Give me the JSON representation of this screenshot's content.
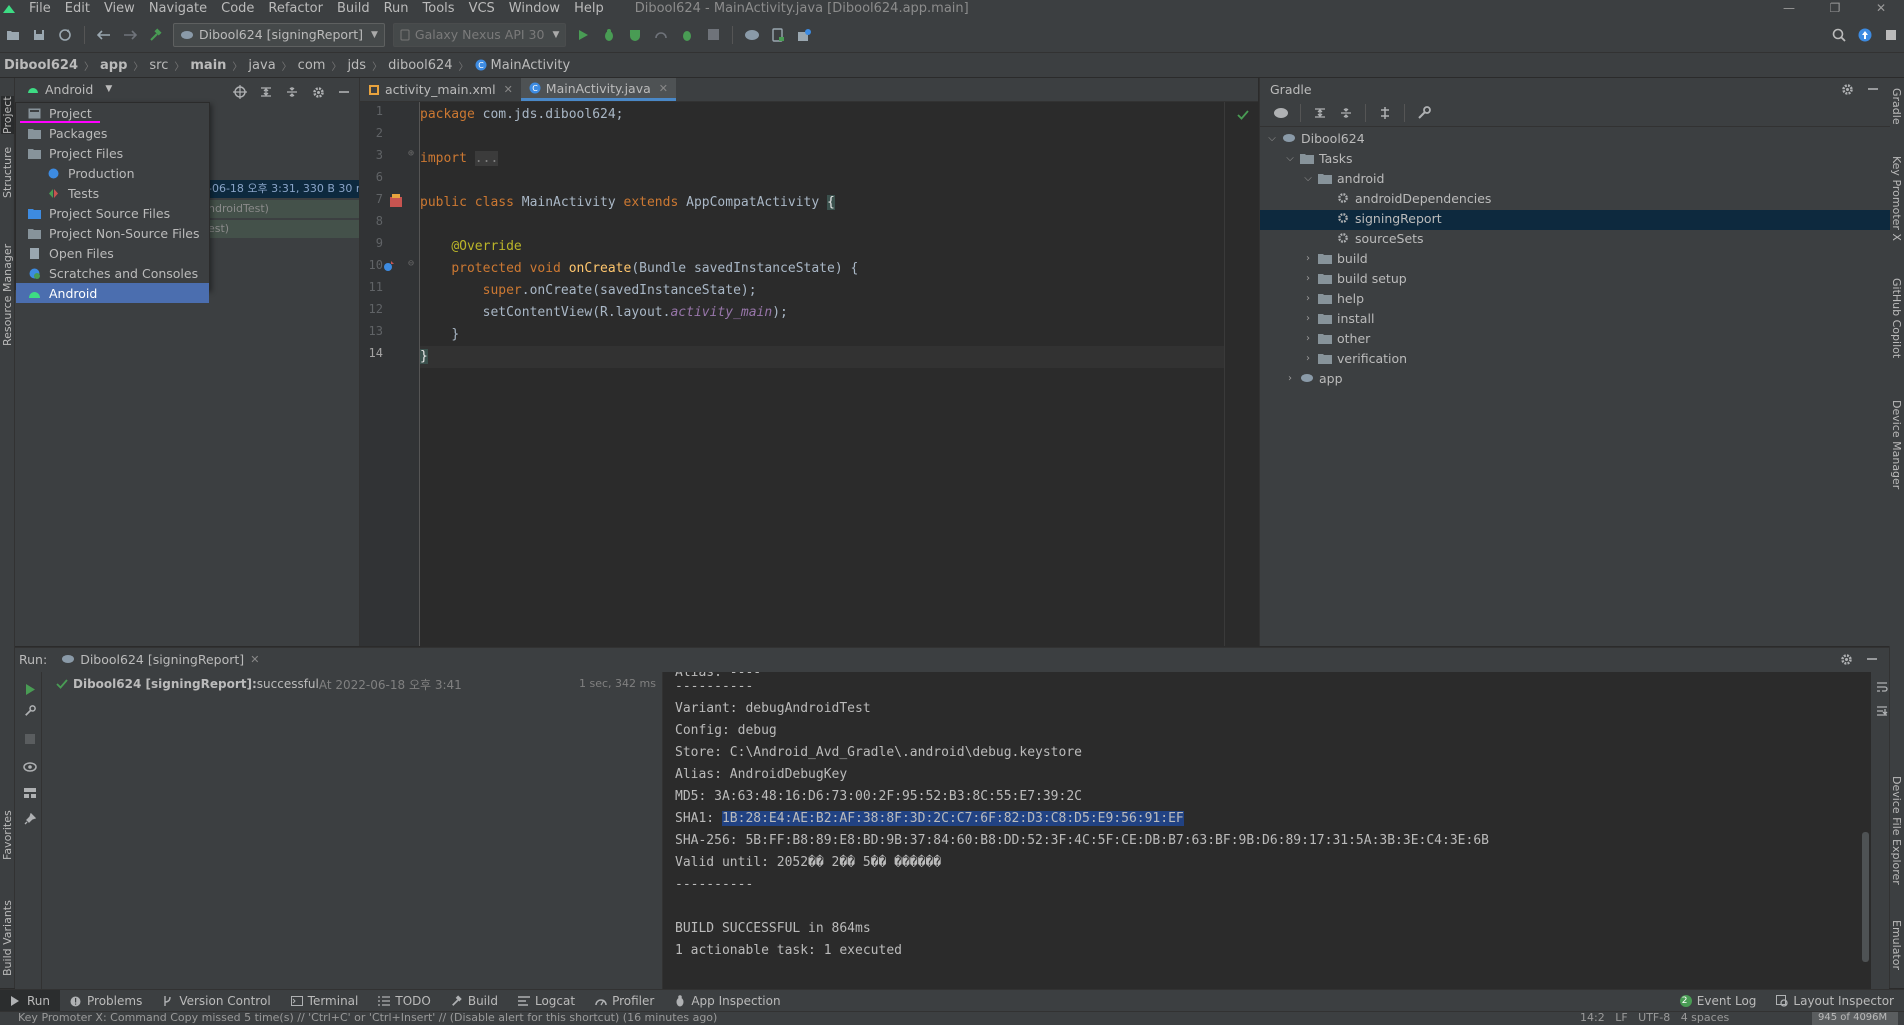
{
  "menu": {
    "items": [
      "File",
      "Edit",
      "View",
      "Navigate",
      "Code",
      "Refactor",
      "Build",
      "Run",
      "Tools",
      "VCS",
      "Window",
      "Help"
    ],
    "window_title": "Dibool624 - MainActivity.java [Dibool624.app.main]"
  },
  "toolbar": {
    "run_config": "Dibool624 [signingReport]",
    "device": "Galaxy Nexus API 30"
  },
  "breadcrumb": [
    "Dibool624",
    "app",
    "src",
    "main",
    "java",
    "com",
    "jds",
    "dibool624",
    "MainActivity"
  ],
  "project_panel": {
    "view_selector": "Android",
    "popup_items": [
      {
        "label": "Project"
      },
      {
        "label": "Packages"
      },
      {
        "label": "Project Files"
      },
      {
        "label": "Production"
      },
      {
        "label": "Tests"
      },
      {
        "label": "Project Source Files"
      },
      {
        "label": "Project Non-Source Files"
      },
      {
        "label": "Open Files"
      },
      {
        "label": "Scratches and Consoles"
      },
      {
        "label": "Android"
      }
    ],
    "selected_item": "Android",
    "behind_text": [
      "-06-18 오후 3:31, 330 B 30 m",
      "ndroidTest)",
      "est)"
    ]
  },
  "editor": {
    "tabs": [
      {
        "label": "activity_main.xml",
        "active": false
      },
      {
        "label": "MainActivity.java",
        "active": true
      }
    ],
    "line_numbers": [
      "1",
      "2",
      "3",
      "6",
      "7",
      "8",
      "9",
      "10",
      "11",
      "12",
      "13",
      "14"
    ],
    "current_line": "14",
    "code": {
      "l1_kw": "package",
      "l1_rest": " com.jds.dibool624;",
      "l3_kw": "import",
      "l3_fold": "...",
      "l7_kw": "public class",
      "l7_name": " MainActivity ",
      "l7_kw2": "extends",
      "l7_rest": " AppCompatActivity ",
      "l7_brace": "{",
      "l9_ann": "@Override",
      "l10_kw": "protected void",
      "l10_fn": "onCreate",
      "l10_rest": "(Bundle savedInstanceState) {",
      "l11_kw": "super",
      "l11_rest": ".onCreate(savedInstanceState);",
      "l12_a": "setContentView(R.layout.",
      "l12_fld": "activity_main",
      "l12_b": ");",
      "l13": "}",
      "l14": "}"
    }
  },
  "gradle": {
    "title": "Gradle",
    "tree": {
      "root": "Dibool624",
      "tasks": "Tasks",
      "android": "android",
      "android_children": [
        "androidDependencies",
        "signingReport",
        "sourceSets"
      ],
      "groups": [
        "build",
        "build setup",
        "help",
        "install",
        "other",
        "verification"
      ],
      "app": "app"
    },
    "selected": "signingReport"
  },
  "run_panel": {
    "label": "Run:",
    "tab_label": "Dibool624 [signingReport]",
    "result_name": "Dibool624 [signingReport]:",
    "result_status": " successful",
    "result_time": " At 2022-06-18 오후 3:41",
    "duration": "1 sec, 342 ms",
    "console_lines": [
      "Variant: debugAndroidTest",
      "Config: debug",
      "Store: C:\\Android_Avd_Gradle\\.android\\debug.keystore",
      "Alias: AndroidDebugKey",
      "MD5: 3A:63:48:16:D6:73:00:2F:95:52:B3:8C:55:E7:39:2C",
      "SHA-256: 5B:FF:B8:89:E8:BD:9B:37:84:60:B8:DD:52:3F:4C:5F:CE:DB:B7:63:BF:9B:D6:89:17:31:5A:3B:3E:C4:3E:6B",
      "Valid until: 2052�� 2�� 5�� ������",
      "----------",
      "BUILD SUCCESSFUL in 864ms",
      "1 actionable task: 1 executed"
    ],
    "separator_top": "----------",
    "sha1_label": "SHA1: ",
    "sha1_value": "1B:28:E4:AE:B2:AF:38:8F:3D:2C:C7:6F:82:D3:C8:D5:E9:56:91:EF"
  },
  "bottom_tools": {
    "left": [
      "Run",
      "Problems",
      "Version Control",
      "Terminal",
      "TODO",
      "Build",
      "Logcat",
      "Profiler",
      "App Inspection"
    ],
    "right": [
      "Event Log",
      "Layout Inspector"
    ],
    "event_count": "2"
  },
  "status": {
    "message": "Key Promoter X: Command Copy missed 5 time(s) // 'Ctrl+C' or 'Ctrl+Insert' // (Disable alert for this shortcut) (16 minutes ago)",
    "right": "14:2   LF   UTF-8   4 spaces",
    "memory": "945 of 4096M"
  },
  "stripes": {
    "left": [
      "Project",
      "Structure",
      "Resource Manager",
      "Favorites",
      "Build Variants"
    ],
    "right": [
      "Gradle",
      "Key Promoter X",
      "GitHub Copilot",
      "Device Manager",
      "Device File Explorer",
      "Emulator"
    ]
  },
  "colors": {
    "bg": "#2b2b2b",
    "panel": "#3c3f41",
    "selection": "#4b6eaf",
    "keyword": "#cc7832",
    "annotation": "#bbb529",
    "function": "#ffc66d",
    "success": "#499c54",
    "underline": "#ff00ff"
  }
}
